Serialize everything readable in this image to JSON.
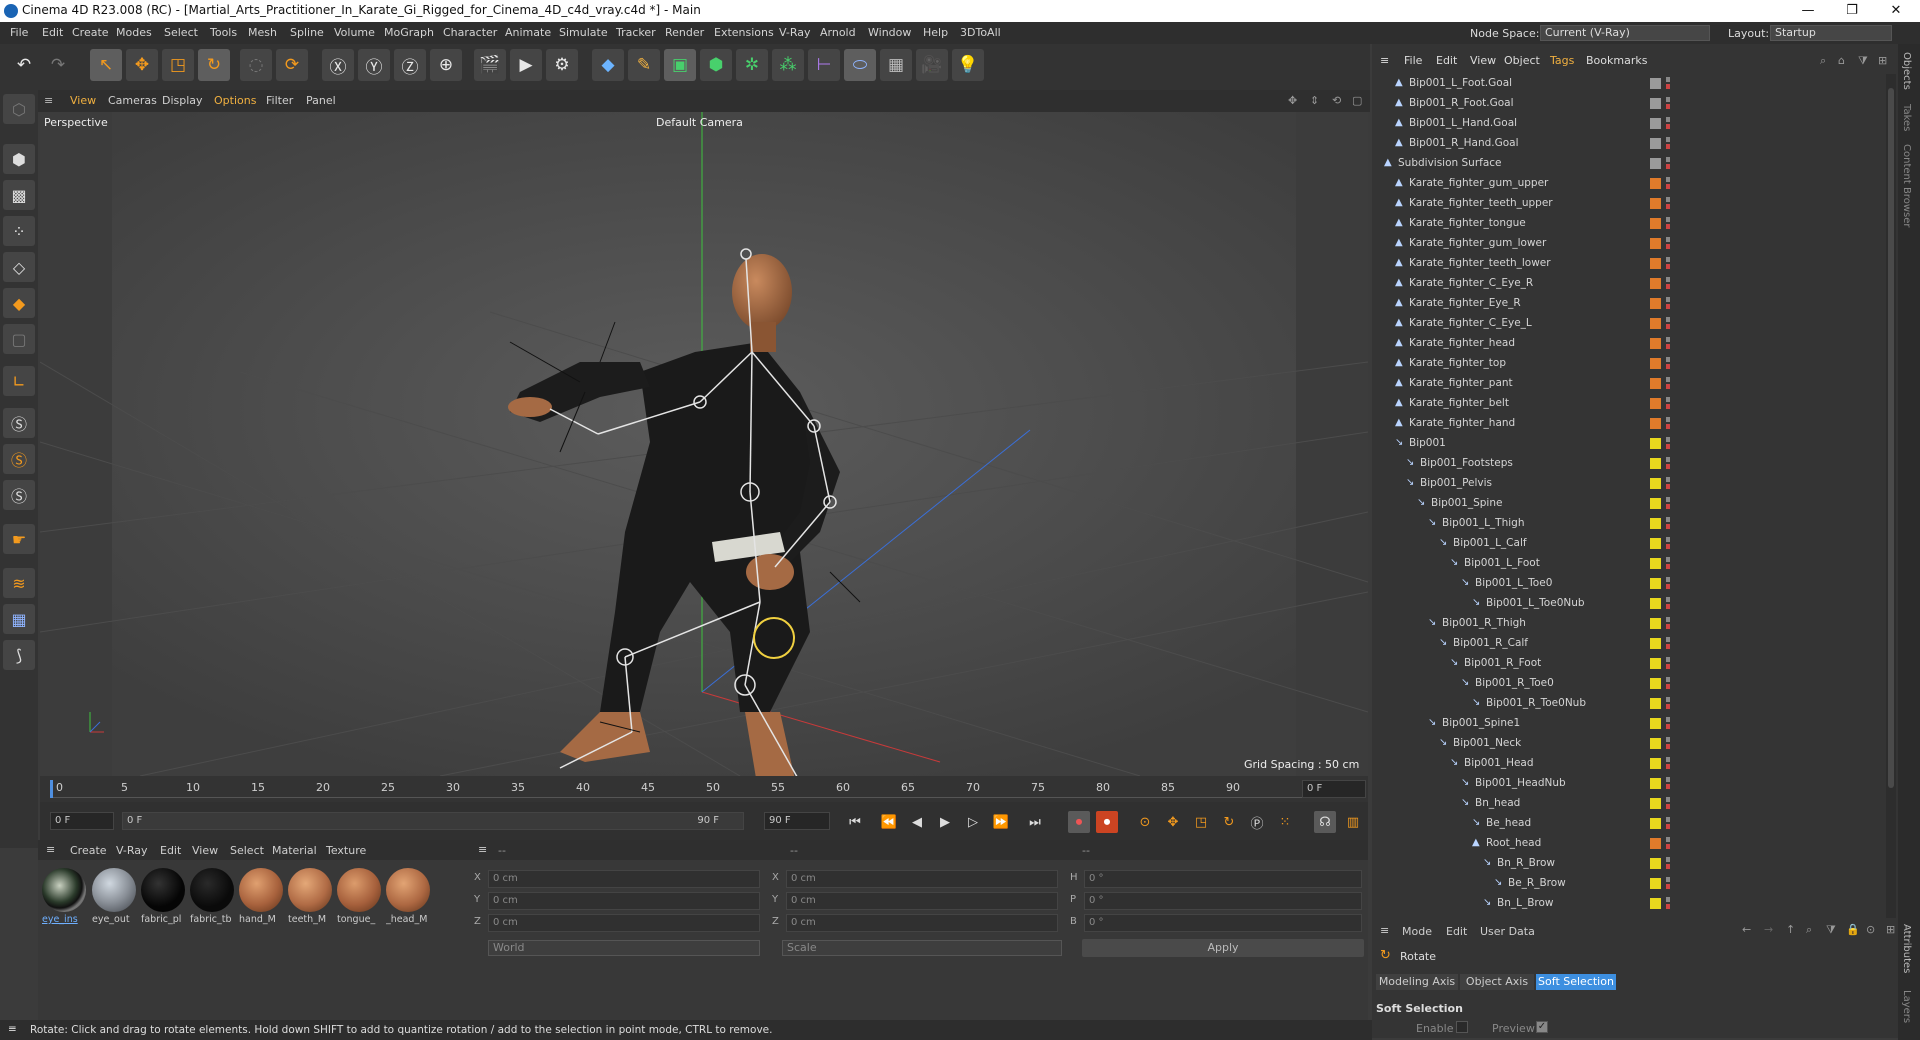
{
  "window": {
    "title": "Cinema 4D R23.008 (RC) - [Martial_Arts_Practitioner_In_Karate_Gi_Rigged_for_Cinema_4D_c4d_vray.c4d *] - Main",
    "minimize": "—",
    "maximize": "❐",
    "close": "✕"
  },
  "menu": [
    "File",
    "Edit",
    "Create",
    "Modes",
    "Select",
    "Tools",
    "Mesh",
    "Spline",
    "Volume",
    "MoGraph",
    "Character",
    "Animate",
    "Simulate",
    "Tracker",
    "Render",
    "Extensions",
    "V-Ray",
    "Arnold",
    "Window",
    "Help",
    "3DToAll"
  ],
  "node_space": {
    "label": "Node Space:",
    "value": "Current (V-Ray)"
  },
  "layout": {
    "label": "Layout:",
    "value": "Startup"
  },
  "viewport": {
    "menu": [
      "View",
      "Cameras",
      "Display",
      "Options",
      "Filter",
      "Panel"
    ],
    "name": "Perspective",
    "camera": "Default Camera",
    "grid_spacing": "Grid Spacing : 50 cm"
  },
  "timeline": {
    "ticks": [
      "0",
      "5",
      "10",
      "15",
      "20",
      "25",
      "30",
      "35",
      "40",
      "45",
      "50",
      "55",
      "60",
      "65",
      "70",
      "75",
      "80",
      "85",
      "90"
    ],
    "current": "0 F"
  },
  "transport": {
    "start": "0 F",
    "range_start": "0 F",
    "range_end": "90 F",
    "end": "90 F"
  },
  "material_manager": {
    "menu": [
      "Create",
      "V-Ray",
      "Edit",
      "View",
      "Select",
      "Material",
      "Texture"
    ],
    "materials": [
      {
        "name": "eye_ins",
        "color": "#6b7068",
        "selected": true
      },
      {
        "name": "eye_out",
        "color": "#8a9098"
      },
      {
        "name": "fabric_pl",
        "color": "#050505"
      },
      {
        "name": "fabric_tb",
        "color": "#0a0a0a"
      },
      {
        "name": "hand_M",
        "color": "#a8623d"
      },
      {
        "name": "teeth_M",
        "color": "#b06b45"
      },
      {
        "name": "tongue_",
        "color": "#a6603c"
      },
      {
        "name": "_head_M",
        "color": "#ad6842"
      }
    ]
  },
  "coords": {
    "header_left": "--",
    "header_mid": "--",
    "header_right": "--",
    "x": "0 cm",
    "y": "0 cm",
    "z": "0 cm",
    "sx": "0 cm",
    "sy": "0 cm",
    "sz": "0 cm",
    "h": "0 °",
    "p": "0 °",
    "b": "0 °",
    "space": "World",
    "mode": "Scale",
    "apply": "Apply"
  },
  "objects": {
    "menu": [
      "File",
      "Edit",
      "View",
      "Object",
      "Tags",
      "Bookmarks"
    ],
    "rows": [
      {
        "name": "Bip001_L_Foot.Goal",
        "depth": 1,
        "layer": "#9a9a9a"
      },
      {
        "name": "Bip001_R_Foot.Goal",
        "depth": 1,
        "layer": "#9a9a9a"
      },
      {
        "name": "Bip001_L_Hand.Goal",
        "depth": 1,
        "layer": "#9a9a9a"
      },
      {
        "name": "Bip001_R_Hand.Goal",
        "depth": 1,
        "layer": "#9a9a9a"
      },
      {
        "name": "Subdivision Surface",
        "depth": 0,
        "layer": "#9a9a9a"
      },
      {
        "name": "Karate_fighter_gum_upper",
        "depth": 1,
        "layer": "#e07b2b"
      },
      {
        "name": "Karate_fighter_teeth_upper",
        "depth": 1,
        "layer": "#e07b2b"
      },
      {
        "name": "Karate_fighter_tongue",
        "depth": 1,
        "layer": "#e07b2b"
      },
      {
        "name": "Karate_fighter_gum_lower",
        "depth": 1,
        "layer": "#e07b2b"
      },
      {
        "name": "Karate_fighter_teeth_lower",
        "depth": 1,
        "layer": "#e07b2b"
      },
      {
        "name": "Karate_fighter_C_Eye_R",
        "depth": 1,
        "layer": "#e07b2b"
      },
      {
        "name": "Karate_fighter_Eye_R",
        "depth": 1,
        "layer": "#e07b2b"
      },
      {
        "name": "Karate_fighter_C_Eye_L",
        "depth": 1,
        "layer": "#e07b2b"
      },
      {
        "name": "Karate_fighter_head",
        "depth": 1,
        "layer": "#e07b2b"
      },
      {
        "name": "Karate_fighter_top",
        "depth": 1,
        "layer": "#e07b2b"
      },
      {
        "name": "Karate_fighter_pant",
        "depth": 1,
        "layer": "#e07b2b"
      },
      {
        "name": "Karate_fighter_belt",
        "depth": 1,
        "layer": "#e07b2b"
      },
      {
        "name": "Karate_fighter_hand",
        "depth": 1,
        "layer": "#e07b2b"
      },
      {
        "name": "Bip001",
        "depth": 1,
        "layer": "#e8d81e"
      },
      {
        "name": "Bip001_Footsteps",
        "depth": 2,
        "layer": "#e8d81e"
      },
      {
        "name": "Bip001_Pelvis",
        "depth": 2,
        "layer": "#e8d81e"
      },
      {
        "name": "Bip001_Spine",
        "depth": 3,
        "layer": "#e8d81e"
      },
      {
        "name": "Bip001_L_Thigh",
        "depth": 4,
        "layer": "#e8d81e"
      },
      {
        "name": "Bip001_L_Calf",
        "depth": 5,
        "layer": "#e8d81e"
      },
      {
        "name": "Bip001_L_Foot",
        "depth": 6,
        "layer": "#e8d81e"
      },
      {
        "name": "Bip001_L_Toe0",
        "depth": 7,
        "layer": "#e8d81e"
      },
      {
        "name": "Bip001_L_Toe0Nub",
        "depth": 8,
        "layer": "#e8d81e"
      },
      {
        "name": "Bip001_R_Thigh",
        "depth": 4,
        "layer": "#e8d81e"
      },
      {
        "name": "Bip001_R_Calf",
        "depth": 5,
        "layer": "#e8d81e"
      },
      {
        "name": "Bip001_R_Foot",
        "depth": 6,
        "layer": "#e8d81e"
      },
      {
        "name": "Bip001_R_Toe0",
        "depth": 7,
        "layer": "#e8d81e"
      },
      {
        "name": "Bip001_R_Toe0Nub",
        "depth": 8,
        "layer": "#e8d81e"
      },
      {
        "name": "Bip001_Spine1",
        "depth": 4,
        "layer": "#e8d81e"
      },
      {
        "name": "Bip001_Neck",
        "depth": 5,
        "layer": "#e8d81e"
      },
      {
        "name": "Bip001_Head",
        "depth": 6,
        "layer": "#e8d81e"
      },
      {
        "name": "Bip001_HeadNub",
        "depth": 7,
        "layer": "#e8d81e"
      },
      {
        "name": "Bn_head",
        "depth": 7,
        "layer": "#e8d81e"
      },
      {
        "name": "Be_head",
        "depth": 8,
        "layer": "#e8d81e"
      },
      {
        "name": "Root_head",
        "depth": 8,
        "layer": "#e07b2b"
      },
      {
        "name": "Bn_R_Brow",
        "depth": 9,
        "layer": "#e8d81e"
      },
      {
        "name": "Be_R_Brow",
        "depth": 10,
        "layer": "#e8d81e"
      },
      {
        "name": "Bn_L_Brow",
        "depth": 9,
        "layer": "#e8d81e"
      }
    ]
  },
  "attributes": {
    "menu": [
      "Mode",
      "Edit",
      "User Data"
    ],
    "title": "Rotate",
    "tabs": [
      "Modeling Axis",
      "Object Axis",
      "Soft Selection"
    ],
    "section": "Soft Selection",
    "enable_label": "Enable",
    "preview_label": "Preview"
  },
  "side_tabs": [
    "Objects",
    "Takes",
    "Content Browser"
  ],
  "side_tabs_bottom": [
    "Attributes",
    "Layers"
  ],
  "status": "Rotate: Click and drag to rotate elements. Hold down SHIFT to add to quantize rotation / add to the selection in point mode, CTRL to remove.",
  "colors": {
    "accent": "#f39a1e",
    "selected_tab": "#3d8fe0",
    "x_axis": "#e04040",
    "y_axis": "#40c040",
    "z_axis": "#3a6fd8"
  }
}
